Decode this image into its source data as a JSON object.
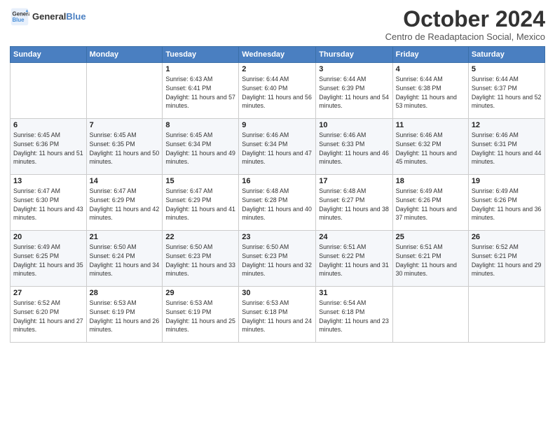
{
  "header": {
    "logo_line1": "General",
    "logo_line2": "Blue",
    "month": "October 2024",
    "location": "Centro de Readaptacion Social, Mexico"
  },
  "days_of_week": [
    "Sunday",
    "Monday",
    "Tuesday",
    "Wednesday",
    "Thursday",
    "Friday",
    "Saturday"
  ],
  "weeks": [
    [
      {
        "day": "",
        "info": ""
      },
      {
        "day": "",
        "info": ""
      },
      {
        "day": "1",
        "info": "Sunrise: 6:43 AM\nSunset: 6:41 PM\nDaylight: 11 hours and 57 minutes."
      },
      {
        "day": "2",
        "info": "Sunrise: 6:44 AM\nSunset: 6:40 PM\nDaylight: 11 hours and 56 minutes."
      },
      {
        "day": "3",
        "info": "Sunrise: 6:44 AM\nSunset: 6:39 PM\nDaylight: 11 hours and 54 minutes."
      },
      {
        "day": "4",
        "info": "Sunrise: 6:44 AM\nSunset: 6:38 PM\nDaylight: 11 hours and 53 minutes."
      },
      {
        "day": "5",
        "info": "Sunrise: 6:44 AM\nSunset: 6:37 PM\nDaylight: 11 hours and 52 minutes."
      }
    ],
    [
      {
        "day": "6",
        "info": "Sunrise: 6:45 AM\nSunset: 6:36 PM\nDaylight: 11 hours and 51 minutes."
      },
      {
        "day": "7",
        "info": "Sunrise: 6:45 AM\nSunset: 6:35 PM\nDaylight: 11 hours and 50 minutes."
      },
      {
        "day": "8",
        "info": "Sunrise: 6:45 AM\nSunset: 6:34 PM\nDaylight: 11 hours and 49 minutes."
      },
      {
        "day": "9",
        "info": "Sunrise: 6:46 AM\nSunset: 6:34 PM\nDaylight: 11 hours and 47 minutes."
      },
      {
        "day": "10",
        "info": "Sunrise: 6:46 AM\nSunset: 6:33 PM\nDaylight: 11 hours and 46 minutes."
      },
      {
        "day": "11",
        "info": "Sunrise: 6:46 AM\nSunset: 6:32 PM\nDaylight: 11 hours and 45 minutes."
      },
      {
        "day": "12",
        "info": "Sunrise: 6:46 AM\nSunset: 6:31 PM\nDaylight: 11 hours and 44 minutes."
      }
    ],
    [
      {
        "day": "13",
        "info": "Sunrise: 6:47 AM\nSunset: 6:30 PM\nDaylight: 11 hours and 43 minutes."
      },
      {
        "day": "14",
        "info": "Sunrise: 6:47 AM\nSunset: 6:29 PM\nDaylight: 11 hours and 42 minutes."
      },
      {
        "day": "15",
        "info": "Sunrise: 6:47 AM\nSunset: 6:29 PM\nDaylight: 11 hours and 41 minutes."
      },
      {
        "day": "16",
        "info": "Sunrise: 6:48 AM\nSunset: 6:28 PM\nDaylight: 11 hours and 40 minutes."
      },
      {
        "day": "17",
        "info": "Sunrise: 6:48 AM\nSunset: 6:27 PM\nDaylight: 11 hours and 38 minutes."
      },
      {
        "day": "18",
        "info": "Sunrise: 6:49 AM\nSunset: 6:26 PM\nDaylight: 11 hours and 37 minutes."
      },
      {
        "day": "19",
        "info": "Sunrise: 6:49 AM\nSunset: 6:26 PM\nDaylight: 11 hours and 36 minutes."
      }
    ],
    [
      {
        "day": "20",
        "info": "Sunrise: 6:49 AM\nSunset: 6:25 PM\nDaylight: 11 hours and 35 minutes."
      },
      {
        "day": "21",
        "info": "Sunrise: 6:50 AM\nSunset: 6:24 PM\nDaylight: 11 hours and 34 minutes."
      },
      {
        "day": "22",
        "info": "Sunrise: 6:50 AM\nSunset: 6:23 PM\nDaylight: 11 hours and 33 minutes."
      },
      {
        "day": "23",
        "info": "Sunrise: 6:50 AM\nSunset: 6:23 PM\nDaylight: 11 hours and 32 minutes."
      },
      {
        "day": "24",
        "info": "Sunrise: 6:51 AM\nSunset: 6:22 PM\nDaylight: 11 hours and 31 minutes."
      },
      {
        "day": "25",
        "info": "Sunrise: 6:51 AM\nSunset: 6:21 PM\nDaylight: 11 hours and 30 minutes."
      },
      {
        "day": "26",
        "info": "Sunrise: 6:52 AM\nSunset: 6:21 PM\nDaylight: 11 hours and 29 minutes."
      }
    ],
    [
      {
        "day": "27",
        "info": "Sunrise: 6:52 AM\nSunset: 6:20 PM\nDaylight: 11 hours and 27 minutes."
      },
      {
        "day": "28",
        "info": "Sunrise: 6:53 AM\nSunset: 6:19 PM\nDaylight: 11 hours and 26 minutes."
      },
      {
        "day": "29",
        "info": "Sunrise: 6:53 AM\nSunset: 6:19 PM\nDaylight: 11 hours and 25 minutes."
      },
      {
        "day": "30",
        "info": "Sunrise: 6:53 AM\nSunset: 6:18 PM\nDaylight: 11 hours and 24 minutes."
      },
      {
        "day": "31",
        "info": "Sunrise: 6:54 AM\nSunset: 6:18 PM\nDaylight: 11 hours and 23 minutes."
      },
      {
        "day": "",
        "info": ""
      },
      {
        "day": "",
        "info": ""
      }
    ]
  ]
}
